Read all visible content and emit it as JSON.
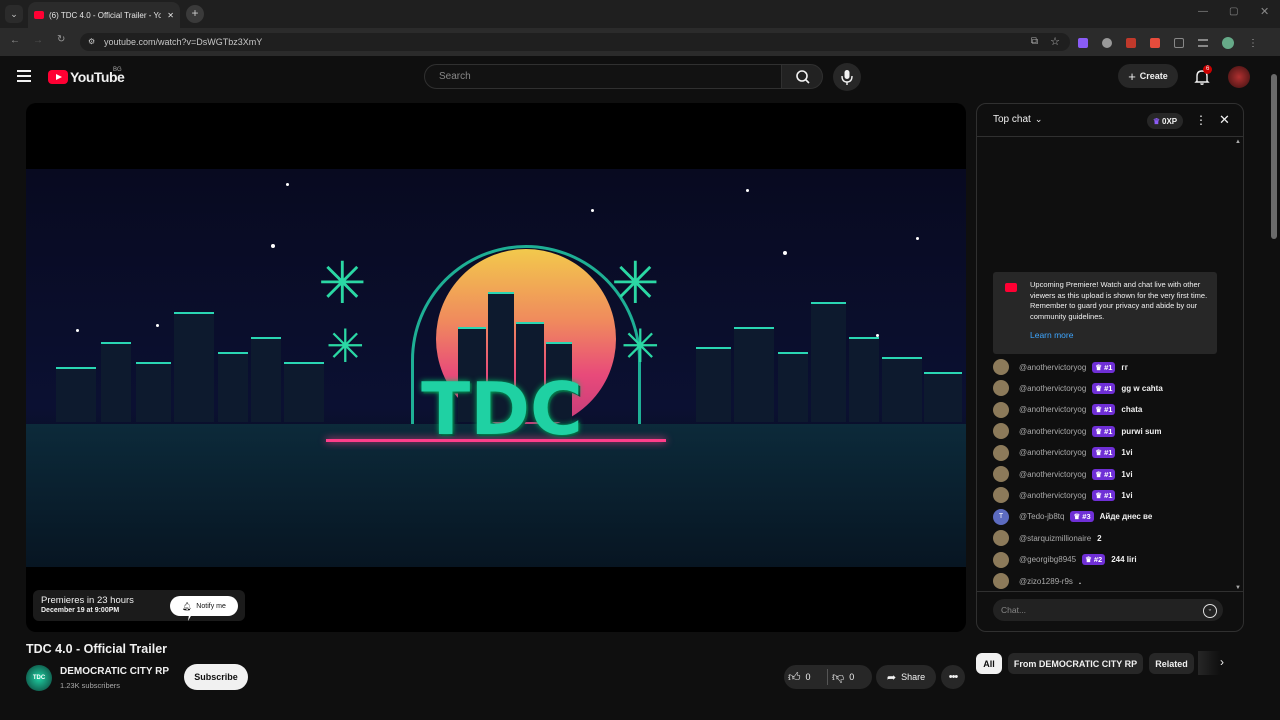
{
  "browser": {
    "tab_title": "(6) TDC 4.0 - Official Trailer - Yo",
    "url": "youtube.com/watch?v=DsWGTbz3XmY"
  },
  "header": {
    "logo_text": "YouTube",
    "country_code": "BG",
    "search_placeholder": "Search",
    "create_label": "Create",
    "notification_count": "6"
  },
  "player": {
    "art_text": "TDC",
    "premiere_title": "Premieres in 23 hours",
    "premiere_date": "December 19 at 9:00PM",
    "notify_label": "Notify me"
  },
  "video": {
    "title": "TDC 4.0 - Official Trailer",
    "channel_name": "DEMOCRATIC CITY RP",
    "channel_avatar_text": "TDC",
    "subscribers": "1.23K subscribers",
    "subscribe_label": "Subscribe",
    "likes": "0",
    "dislikes": "0",
    "share_label": "Share"
  },
  "chat": {
    "mode_label": "Top chat",
    "xp_label": "0XP",
    "notice_text": "Upcoming Premiere! Watch and chat live with other viewers as this upload is shown for the very first time. Remember to guard your privacy and abide by our community guidelines.",
    "learn_more": "Learn more",
    "input_placeholder": "Chat...",
    "messages": [
      {
        "author": "@anothervictoryog",
        "badge": "#1",
        "text": "гг",
        "avatar": ""
      },
      {
        "author": "@anothervictoryog",
        "badge": "#1",
        "text": "gg w cahta",
        "avatar": ""
      },
      {
        "author": "@anothervictoryog",
        "badge": "#1",
        "text": "chata",
        "avatar": ""
      },
      {
        "author": "@anothervictoryog",
        "badge": "#1",
        "text": "purwi sum",
        "avatar": ""
      },
      {
        "author": "@anothervictoryog",
        "badge": "#1",
        "text": "1vi",
        "avatar": ""
      },
      {
        "author": "@anothervictoryog",
        "badge": "#1",
        "text": "1vi",
        "avatar": ""
      },
      {
        "author": "@anothervictoryog",
        "badge": "#1",
        "text": "1vi",
        "avatar": ""
      },
      {
        "author": "@Tedo-jb8tq",
        "badge": "#3",
        "text": "Айде днес ве",
        "avatar": "T"
      },
      {
        "author": "@starquizmillionaire",
        "badge": "",
        "text": "2",
        "avatar": ""
      },
      {
        "author": "@georgibg8945",
        "badge": "#2",
        "text": "244 liri",
        "avatar": ""
      },
      {
        "author": "@zizo1289-r9s",
        "badge": "",
        "text": ".",
        "avatar": ""
      }
    ]
  },
  "chips": [
    "All",
    "From DEMOCRATIC CITY RP",
    "Related"
  ],
  "colors": {
    "youtube_red": "#ff0033",
    "member_badge": "#6f2fd6",
    "link_blue": "#3ea6ff",
    "tdc_teal": "#1fd1a3"
  }
}
